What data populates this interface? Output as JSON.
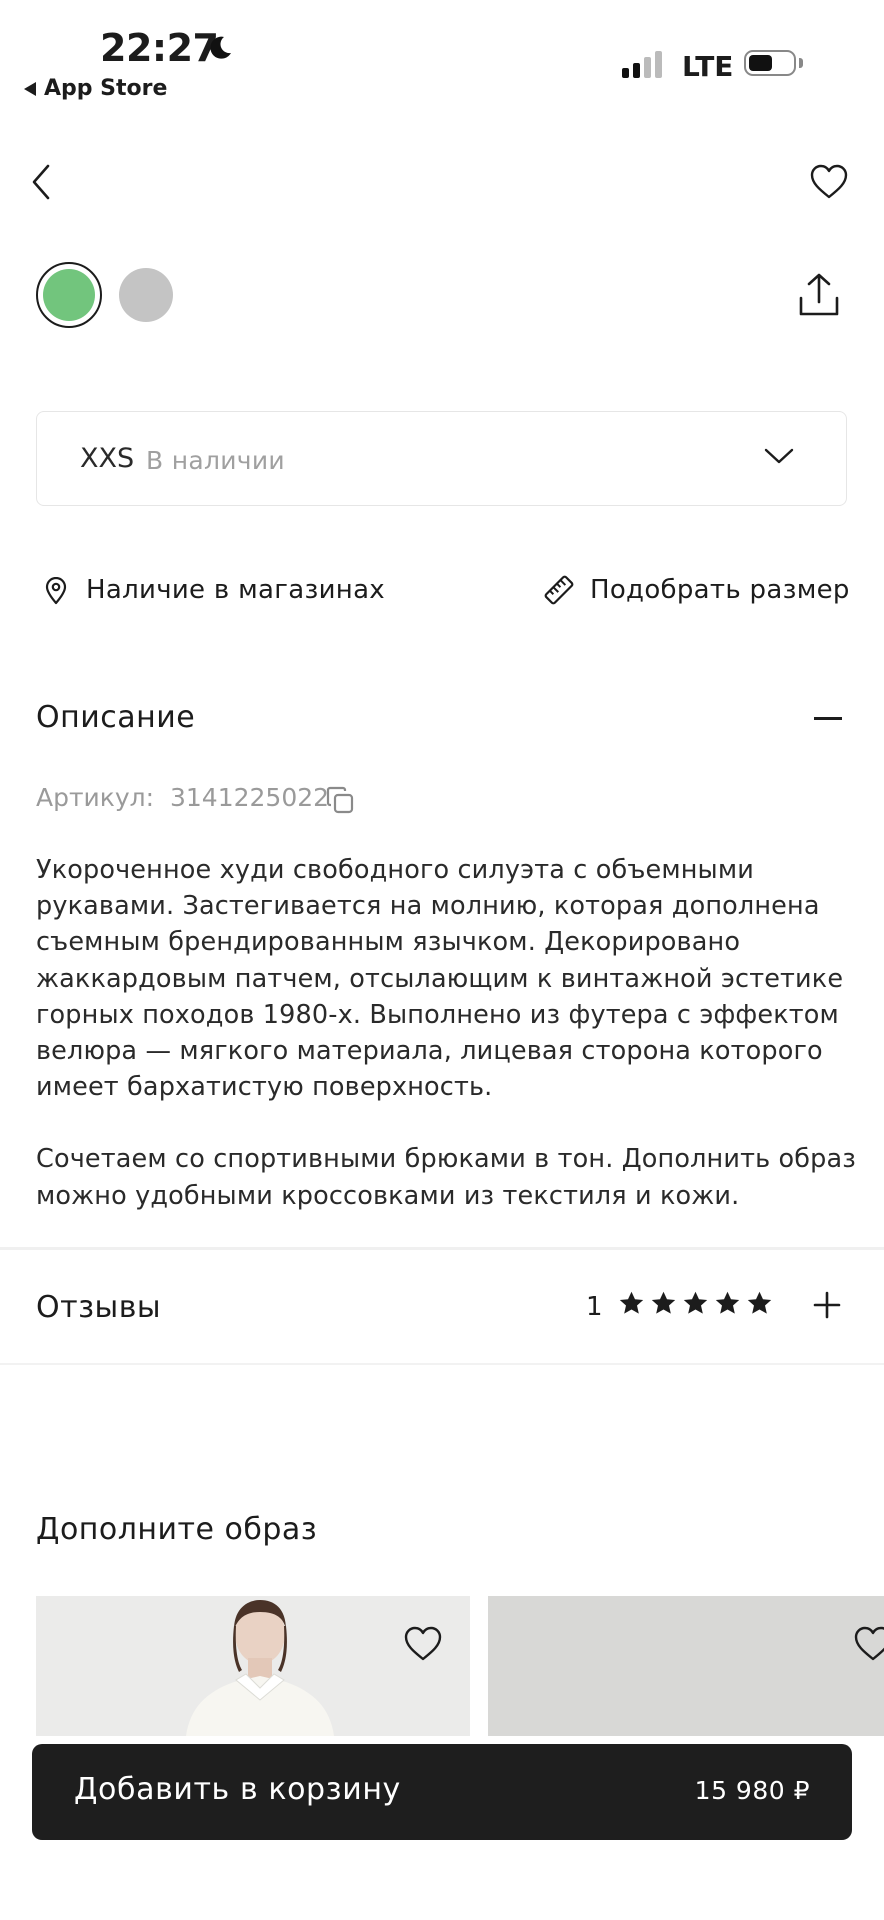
{
  "status_bar": {
    "time": "22:27",
    "back_app": "App Store",
    "network": "LTE",
    "icons": [
      "moon-icon",
      "signal-icon",
      "battery-icon"
    ]
  },
  "toolbar": {
    "icons": [
      "back-chevron-icon",
      "heart-icon",
      "share-icon"
    ]
  },
  "colors": {
    "swatches": [
      "#72c57d",
      "#c4c4c4"
    ],
    "selected_index": 0
  },
  "size_select": {
    "value": "XXS",
    "stock": "В наличии",
    "icon": "chevron-down-icon"
  },
  "links": {
    "stores": "Наличие в магазинах",
    "size_guide": "Подобрать размер"
  },
  "description": {
    "title": "Описание",
    "article_label": "Артикул:",
    "article_value": "3141225022",
    "paragraph1": "Укороченное худи свободного силуэта с объемными рукавами. Застегивается на молнию, которая дополнена съемным брендированным язычком. Декорировано жаккардовым патчем, отсылающим к винтажной эстетике горных походов 1980-х. Выполнено из футера с эффектом велюра — мягкого материала, лицевая сторона которого имеет бархатистую поверхность.",
    "paragraph2": "Сочетаем со спортивными брюками в тон. Дополнить образ можно удобными кроссовками из текстиля и кожи."
  },
  "reviews": {
    "title": "Отзывы",
    "count": "1",
    "rating": 5,
    "max_rating": 5
  },
  "complete_look": {
    "title": "Дополните образ"
  },
  "cart": {
    "label": "Добавить в корзину",
    "price": "15 980 ₽"
  }
}
